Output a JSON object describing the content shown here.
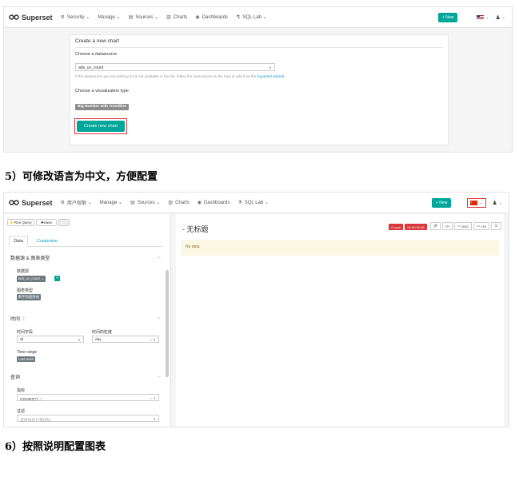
{
  "panel1": {
    "nav": {
      "logo": "Superset",
      "items": [
        "Security",
        "Manage",
        "Sources",
        "Charts",
        "Dashboards",
        "SQL Lab"
      ],
      "new_button": "+ New"
    },
    "card_title": "Create a new chart",
    "datasource_label": "Choose a datasource",
    "datasource_value": "ads_uv_count",
    "hint_prefix": "If the datasource you are looking for is not available in the list, follow the instructions on the how to add it on the ",
    "hint_link": "Superset tutorial",
    "viz_label": "Choose a visualization type",
    "viz_value": "Big Number with Trendline",
    "create_button": "Create new chart"
  },
  "heading5": "5）可修改语言为中文，方便配置",
  "panel2": {
    "nav": {
      "logo": "Superset",
      "items": [
        "用户权限",
        "Manage",
        "Sources",
        "Charts",
        "Dashboards",
        "SQL Lab"
      ],
      "new_button": "+ New"
    },
    "toolbar": {
      "run_query": "Run Query",
      "save": "Save"
    },
    "tabs": [
      "Data",
      "Customize"
    ],
    "sections": {
      "datasource_section": "数据源 & 图表类型",
      "datasource_label": "数据源",
      "datasource_value": "ads_uv_count",
      "chart_type_label": "图表类型",
      "chart_type_value": "数字和趋势线",
      "time_section": "时间",
      "time_col_label": "时间字段",
      "time_col_value": "dt",
      "time_grain_label": "时间的粒度",
      "time_grain_value": "day",
      "time_range_label": "Time range",
      "time_range_value": "Last week",
      "query_section": "查询",
      "metric_label": "指标",
      "metric_value": "COUNT(*)",
      "filter_label": "过滤",
      "filter_placeholder": "选择和统计量指标"
    },
    "chart_title": "- 无标题",
    "badge_rows": "0 rows",
    "badge_time": "00:00:00.05",
    "buttons": [
      "json",
      "csv"
    ],
    "nodata": "No data"
  },
  "heading6": "6）按照说明配置图表",
  "colors": {
    "accent": "#00a699",
    "highlight": "#d9383a"
  }
}
